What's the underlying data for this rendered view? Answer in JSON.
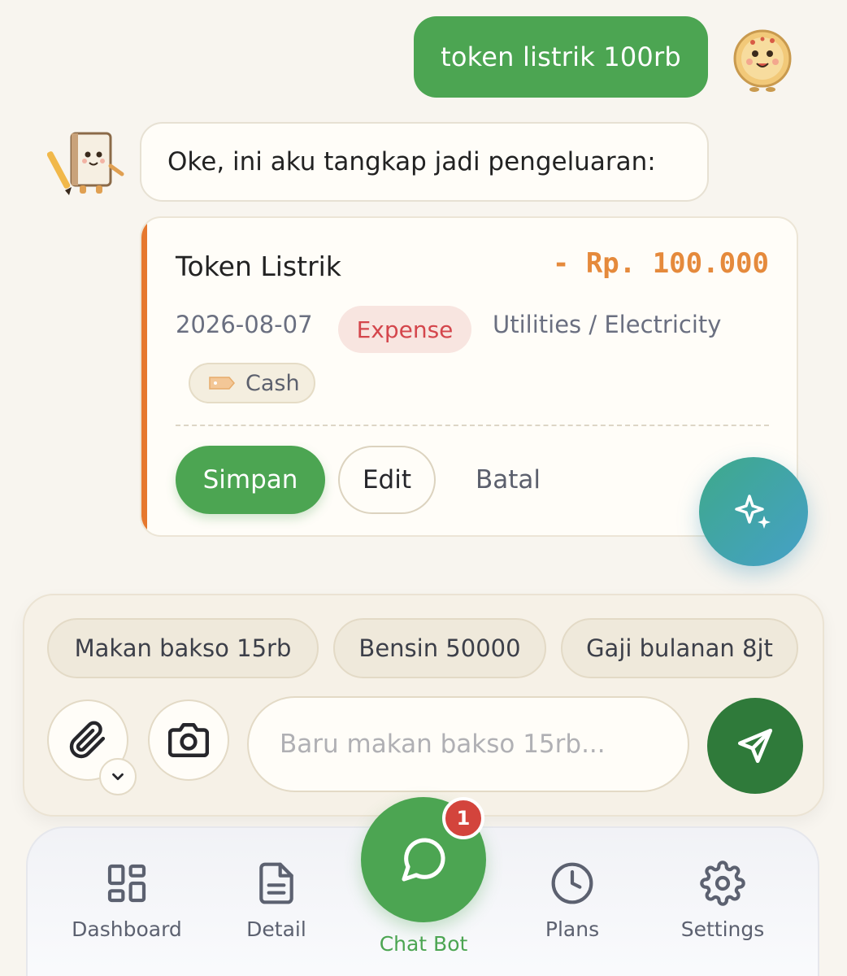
{
  "chat": {
    "user_message": "token listrik 100rb",
    "bot_message": "Oke, ini aku tangkap jadi pengeluaran:"
  },
  "transaction": {
    "title": "Token Listrik",
    "amount": "- Rp. 100.000",
    "date": "2026-08-07",
    "type": "Expense",
    "category": "Utilities / Electricity",
    "payment_method": "Cash",
    "accent_color": "#e6782e",
    "actions": {
      "save": "Simpan",
      "edit": "Edit",
      "cancel": "Batal"
    }
  },
  "composer": {
    "suggestions": [
      "Makan bakso 15rb",
      "Bensin 50000",
      "Gaji bulanan 8jt"
    ],
    "input_placeholder": "Baru makan bakso 15rb...",
    "input_value": ""
  },
  "nav": {
    "items": [
      {
        "label": "Dashboard",
        "icon": "dashboard-grid-icon"
      },
      {
        "label": "Detail",
        "icon": "document-icon"
      },
      {
        "label": "Chat Bot",
        "icon": "chat-bubble-icon",
        "active": true,
        "badge": "1"
      },
      {
        "label": "Plans",
        "icon": "clock-icon"
      },
      {
        "label": "Settings",
        "icon": "gear-icon"
      }
    ]
  },
  "colors": {
    "primary_green": "#4ca552",
    "dark_green": "#2f7a3a",
    "expense_red": "#d4464c",
    "amount_orange": "#e58a3c",
    "background": "#f8f5ef"
  }
}
